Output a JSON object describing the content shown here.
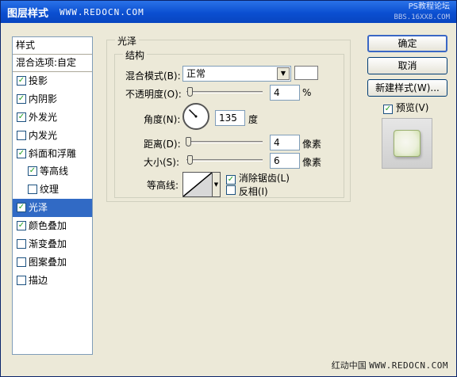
{
  "titlebar": {
    "title": "图层样式",
    "url": "WWW.REDOCN.COM",
    "watermark_line1": "PS教程论坛",
    "watermark_line2": "BBS.16XX8.COM"
  },
  "left_panel": {
    "header": "样式",
    "blend_options": "混合选项:自定",
    "items": [
      {
        "label": "投影",
        "checked": true,
        "sub": false,
        "selected": false
      },
      {
        "label": "内阴影",
        "checked": true,
        "sub": false,
        "selected": false
      },
      {
        "label": "外发光",
        "checked": true,
        "sub": false,
        "selected": false
      },
      {
        "label": "内发光",
        "checked": false,
        "sub": false,
        "selected": false
      },
      {
        "label": "斜面和浮雕",
        "checked": true,
        "sub": false,
        "selected": false
      },
      {
        "label": "等高线",
        "checked": true,
        "sub": true,
        "selected": false
      },
      {
        "label": "纹理",
        "checked": false,
        "sub": true,
        "selected": false
      },
      {
        "label": "光泽",
        "checked": true,
        "sub": false,
        "selected": true
      },
      {
        "label": "颜色叠加",
        "checked": true,
        "sub": false,
        "selected": false
      },
      {
        "label": "渐变叠加",
        "checked": false,
        "sub": false,
        "selected": false
      },
      {
        "label": "图案叠加",
        "checked": false,
        "sub": false,
        "selected": false
      },
      {
        "label": "描边",
        "checked": false,
        "sub": false,
        "selected": false
      }
    ]
  },
  "satin": {
    "group_title": "光泽",
    "structure_title": "结构",
    "blend_mode_label": "混合模式(B):",
    "blend_mode_value": "正常",
    "opacity_label": "不透明度(O):",
    "opacity_value": "4",
    "opacity_unit": "%",
    "opacity_level": 0.04,
    "angle_label": "角度(N):",
    "angle_value": "135",
    "angle_unit": "度",
    "distance_label": "距离(D):",
    "distance_value": "4",
    "distance_unit": "像素",
    "distance_level": 0.02,
    "size_label": "大小(S):",
    "size_value": "6",
    "size_unit": "像素",
    "size_level": 0.04,
    "contour_label": "等高线:",
    "antialias_label": "消除锯齿(L)",
    "antialias_checked": true,
    "invert_label": "反相(I)",
    "invert_checked": false
  },
  "buttons": {
    "ok": "确定",
    "cancel": "取消",
    "new_style": "新建样式(W)...",
    "preview_label": "预览(V)",
    "preview_checked": true
  },
  "footer": {
    "site": "红动中国",
    "url": "WWW.REDOCN.COM"
  },
  "colors": {
    "titlebar": "#0b4fd1",
    "selection": "#316ac5",
    "dialog_bg": "#ece9d8",
    "check": "#21a121"
  }
}
